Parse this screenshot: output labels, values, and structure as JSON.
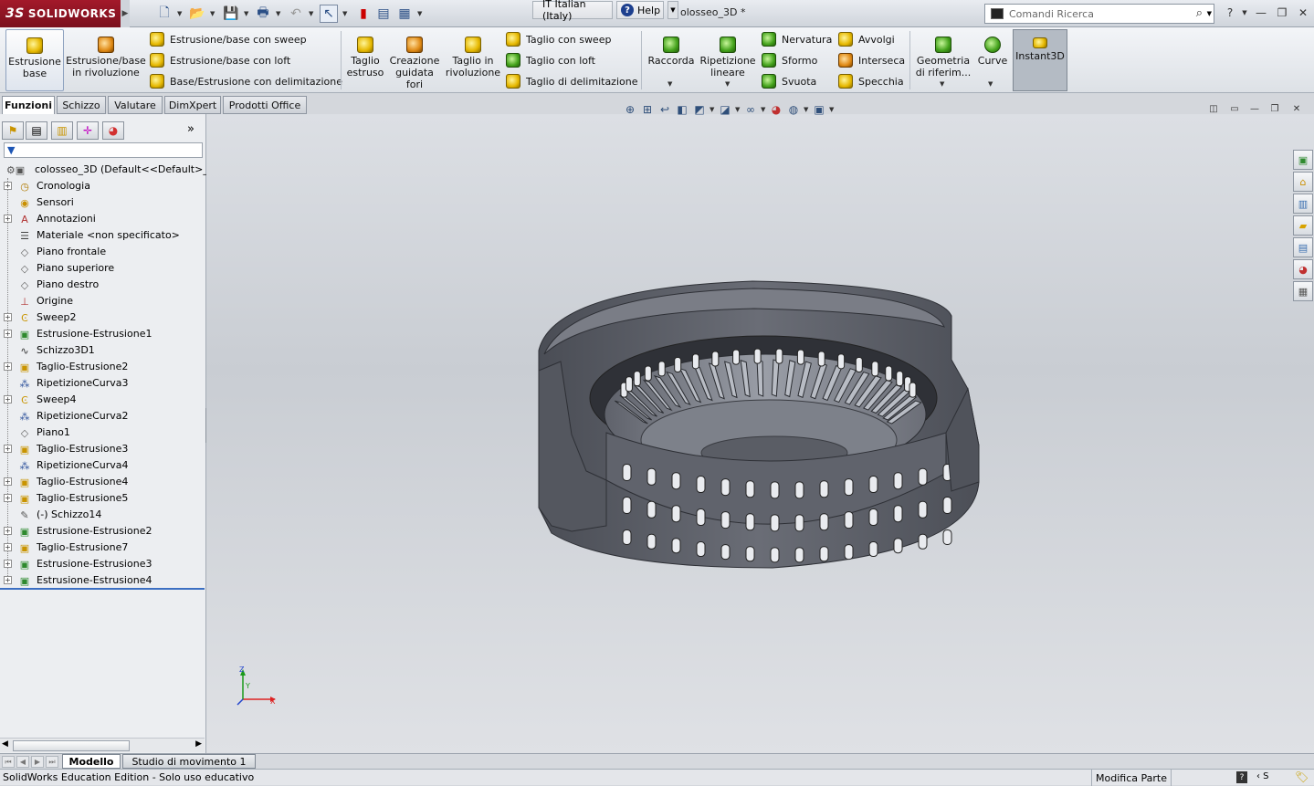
{
  "app": {
    "brand": "SOLIDWORKS",
    "brand_prefix": "3S",
    "document_title": "olosseo_3D *",
    "language_label": "IT  Italian (Italy)",
    "help_label": "Help",
    "search_placeholder": "Comandi Ricerca"
  },
  "ribbon": {
    "big_buttons": [
      {
        "label1": "Estrusione",
        "label2": "base"
      },
      {
        "label1": "Estrusione/base",
        "label2": "in rivoluzione"
      },
      {
        "label1": "Taglio",
        "label2": "estruso"
      },
      {
        "label1": "Creazione",
        "label2": "guidata",
        "label3": "fori"
      },
      {
        "label1": "Taglio in",
        "label2": "rivoluzione"
      },
      {
        "label1": "Raccorda"
      },
      {
        "label1": "Ripetizione",
        "label2": "lineare"
      },
      {
        "label1": "Geometria",
        "label2": "di riferim..."
      },
      {
        "label1": "Curve"
      },
      {
        "label1": "Instant3D"
      }
    ],
    "small_buttons": {
      "sweep_base": "Estrusione/base con sweep",
      "loft_base": "Estrusione/base con loft",
      "boundary_base": "Base/Estrusione con delimitazione",
      "sweep_cut": "Taglio con sweep",
      "loft_cut": "Taglio con loft",
      "boundary_cut": "Taglio di delimitazione",
      "rib": "Nervatura",
      "draft": "Sformo",
      "shell": "Svuota",
      "wrap": "Avvolgi",
      "intersect": "Interseca",
      "mirror": "Specchia"
    }
  },
  "tabs": [
    "Funzioni",
    "Schizzo",
    "Valutare",
    "DimXpert",
    "Prodotti Office"
  ],
  "tree": {
    "root": "colosseo_3D  (Default<<Default>_S",
    "items": [
      {
        "label": "Cronologia",
        "expand": true,
        "icon": "history-icon"
      },
      {
        "label": "Sensori",
        "expand": false,
        "icon": "sensor-icon"
      },
      {
        "label": "Annotazioni",
        "expand": true,
        "icon": "annotation-icon"
      },
      {
        "label": "Materiale <non specificato>",
        "expand": false,
        "icon": "material-icon"
      },
      {
        "label": "Piano frontale",
        "expand": false,
        "icon": "plane-icon"
      },
      {
        "label": "Piano superiore",
        "expand": false,
        "icon": "plane-icon"
      },
      {
        "label": "Piano destro",
        "expand": false,
        "icon": "plane-icon"
      },
      {
        "label": "Origine",
        "expand": false,
        "icon": "origin-icon"
      },
      {
        "label": "Sweep2",
        "expand": true,
        "icon": "sweep-icon"
      },
      {
        "label": "Estrusione-Estrusione1",
        "expand": true,
        "icon": "extrude-icon"
      },
      {
        "label": "Schizzo3D1",
        "expand": false,
        "icon": "sketch3d-icon"
      },
      {
        "label": "Taglio-Estrusione2",
        "expand": true,
        "icon": "cut-extrude-icon"
      },
      {
        "label": "RipetizioneCurva3",
        "expand": false,
        "icon": "curve-pattern-icon"
      },
      {
        "label": "Sweep4",
        "expand": true,
        "icon": "sweep-icon"
      },
      {
        "label": "RipetizioneCurva2",
        "expand": false,
        "icon": "curve-pattern-icon"
      },
      {
        "label": "Piano1",
        "expand": false,
        "icon": "plane-icon"
      },
      {
        "label": "Taglio-Estrusione3",
        "expand": true,
        "icon": "cut-extrude-icon"
      },
      {
        "label": "RipetizioneCurva4",
        "expand": false,
        "icon": "curve-pattern-icon"
      },
      {
        "label": "Taglio-Estrusione4",
        "expand": true,
        "icon": "cut-extrude-icon"
      },
      {
        "label": "Taglio-Estrusione5",
        "expand": true,
        "icon": "cut-extrude-icon"
      },
      {
        "label": "(-) Schizzo14",
        "expand": false,
        "icon": "sketch-icon"
      },
      {
        "label": "Estrusione-Estrusione2",
        "expand": true,
        "icon": "extrude-icon"
      },
      {
        "label": "Taglio-Estrusione7",
        "expand": true,
        "icon": "cut-extrude-icon"
      },
      {
        "label": "Estrusione-Estrusione3",
        "expand": true,
        "icon": "extrude-icon"
      },
      {
        "label": "Estrusione-Estrusione4",
        "expand": true,
        "icon": "extrude-icon"
      }
    ]
  },
  "bottom_tabs": [
    "Modello",
    "Studio di movimento 1"
  ],
  "status": {
    "left": "SolidWorks Education Edition - Solo uso educativo",
    "mode": "Modifica Parte",
    "q": "?",
    "units_hint": "‹ S"
  },
  "triad": {
    "x": "X",
    "y": "Y",
    "z": "Z"
  },
  "colors": {
    "accent": "#3c6fc2",
    "brand": "#a3192a",
    "model": "#5b5e66"
  }
}
